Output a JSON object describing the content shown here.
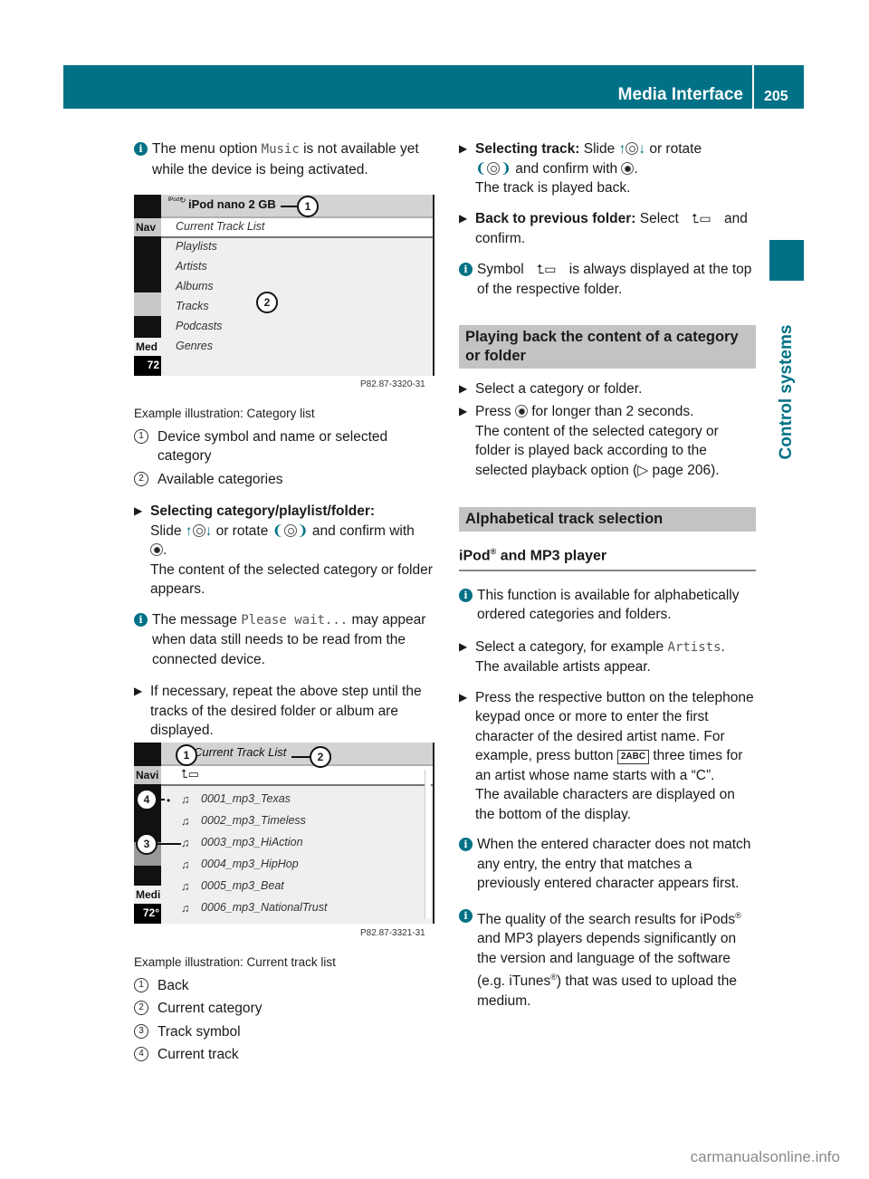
{
  "header": {
    "section_title": "Media Interface",
    "page_number": "205"
  },
  "side_tab": {
    "label": "Control systems"
  },
  "left": {
    "info1": {
      "before": "The menu option ",
      "code": "Music",
      "after": " is not available yet while the device is being activated."
    },
    "figure1": {
      "device_title": "iPod nano 2 GB",
      "side_labels": [
        "Nav",
        "Med",
        "72"
      ],
      "selected_item": "Current Track List",
      "items": [
        "Playlists",
        "Artists",
        "Albums",
        "Tracks",
        "Podcasts",
        "Genres"
      ],
      "callouts": [
        "1",
        "2"
      ],
      "code": "P82.87-3320-31"
    },
    "caption1": "Example illustration: Category list",
    "legend1": [
      {
        "num": "1",
        "text": "Device symbol and name or selected category"
      },
      {
        "num": "2",
        "text": "Available categories"
      }
    ],
    "step1": {
      "bold": "Selecting category/playlist/folder:",
      "t1": "Slide ",
      "t2": " or rotate ",
      "t3": " and confirm with",
      "t4": ".",
      "result": "The content of the selected category or folder appears."
    },
    "info2": {
      "before": "The message ",
      "code": "Please wait...",
      "after": " may appear when data still needs to be read from the connected device."
    },
    "step2": {
      "text": "If necessary, repeat the above step until the tracks of the desired folder or album are displayed."
    },
    "figure2": {
      "title": "Current Track List",
      "side_labels": [
        "Navi",
        "Medi",
        "72°"
      ],
      "tracks": [
        "0001_mp3_Texas",
        "0002_mp3_Timeless",
        "0003_mp3_HiAction",
        "0004_mp3_HipHop",
        "0005_mp3_Beat",
        "0006_mp3_NationalTrust"
      ],
      "callouts": [
        "1",
        "2",
        "3",
        "4"
      ],
      "code": "P82.87-3321-31"
    },
    "caption2": "Example illustration: Current track list",
    "legend2": [
      {
        "num": "1",
        "text": "Back"
      },
      {
        "num": "2",
        "text": "Current category"
      },
      {
        "num": "3",
        "text": "Track symbol"
      },
      {
        "num": "4",
        "text": "Current track"
      }
    ]
  },
  "right": {
    "step_track": {
      "bold": "Selecting track:",
      "t1": " Slide ",
      "t2": " or rotate",
      "t3": " and confirm with ",
      "t4": ".",
      "result": "The track is played back."
    },
    "step_back": {
      "bold": "Back to previous folder:",
      "t1": " Select ",
      "t2": " and confirm."
    },
    "info_symbol": {
      "before": "Symbol ",
      "after": " is always displayed at the top of the respective folder."
    },
    "section1": {
      "title": "Playing back the content of a category or folder"
    },
    "s1_step1": "Select a category or folder.",
    "s1_step2": {
      "before": "Press ",
      "after": " for longer than 2 seconds.",
      "result": "The content of the selected category or folder is played back according to the selected playback option (▷ page 206)."
    },
    "section2": {
      "title": "Alphabetical track selection"
    },
    "subheading": {
      "text": "iPod",
      "reg": "®",
      "rest": " and MP3 player"
    },
    "info_func": "This function is available for alphabetically ordered categories and folders.",
    "s2_step1": {
      "before": "Select a category, for example ",
      "code": "Artists",
      "after": ".",
      "result": "The available artists appear."
    },
    "s2_step2": {
      "before": "Press the respective button on the telephone keypad once or more to enter the first character of the desired artist name. For example, press button ",
      "key": "2ABC",
      "after": " three times for an artist whose name starts with a “C”.",
      "result": "The available characters are displayed on the bottom of the display."
    },
    "info_match": "When the entered character does not match any entry, the entry that matches a previously entered character appears first.",
    "info_quality": {
      "p1": "The quality of the search results for iPods",
      "reg1": "®",
      "p2": " and MP3 players depends significantly on the version and language of the software (e.g. iTunes",
      "reg2": "®",
      "p3": ") that was used to upload the medium."
    }
  },
  "watermark": "carmanualsonline.info"
}
